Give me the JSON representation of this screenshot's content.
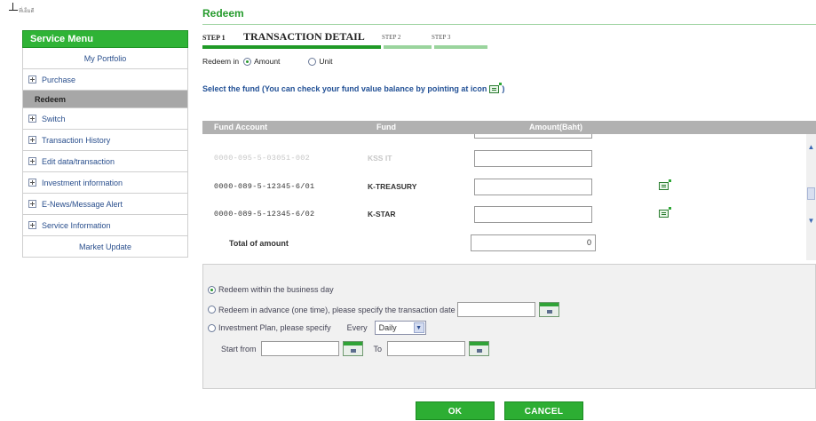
{
  "logo": {
    "text": "ที่เอ็มดี"
  },
  "sidebar": {
    "title": "Service Menu",
    "items": [
      {
        "label": "My Portfolio",
        "icon": "none"
      },
      {
        "label": "Purchase",
        "icon": "plus-icon"
      },
      {
        "label": "Redeem",
        "icon": "none",
        "active": true
      },
      {
        "label": "Switch",
        "icon": "plus-icon"
      },
      {
        "label": "Transaction History",
        "icon": "plus-icon"
      },
      {
        "label": "Edit data/transaction",
        "icon": "plus-icon"
      },
      {
        "label": "Investment information",
        "icon": "plus-icon"
      },
      {
        "label": "E-News/Message Alert",
        "icon": "plus-icon"
      },
      {
        "label": "Service Information",
        "icon": "plus-icon"
      },
      {
        "label": "Market Update",
        "icon": "none"
      }
    ]
  },
  "main": {
    "title": "Redeem",
    "steps": {
      "step1_label": "STEP 1",
      "step1_title": "TRANSACTION DETAIL",
      "step2_label": "STEP 2",
      "step3_label": "STEP 3"
    },
    "redeem_in": {
      "label": "Redeem in",
      "option_amount": "Amount",
      "option_unit": "Unit",
      "selected": "Amount"
    },
    "select_fund_text": "Select the fund (You can check your fund value balance by pointing at icon",
    "select_fund_close": ")",
    "table": {
      "headers": [
        "Fund Account",
        "Fund",
        "Amount(Baht)"
      ],
      "rows": [
        {
          "account": "0000-089-5-12345-6/01",
          "fund": "K-TREASURY",
          "amount": ""
        },
        {
          "account": "0000-089-5-12345-6/02",
          "fund": "K-STAR",
          "amount": ""
        }
      ],
      "faded_row": {
        "account": "0000-095-5-03051-002",
        "fund": "KSS IT"
      },
      "total_label": "Total of amount",
      "total_value": "0"
    },
    "options": {
      "opt1": "Redeem within the business day",
      "opt2": "Redeem in advance (one time), please specify the transaction date",
      "opt3": "Investment Plan, please specify",
      "every_label": "Every",
      "frequency": "Daily",
      "start_label": "Start from",
      "to_label": "To",
      "selected": "opt1"
    },
    "buttons": {
      "ok": "OK",
      "cancel": "CANCEL"
    }
  },
  "colors": {
    "brand_green": "#2fb336",
    "title_green": "#259b2c",
    "link_blue": "#2a4f8d",
    "table_header_gray": "#b1b1b1"
  }
}
